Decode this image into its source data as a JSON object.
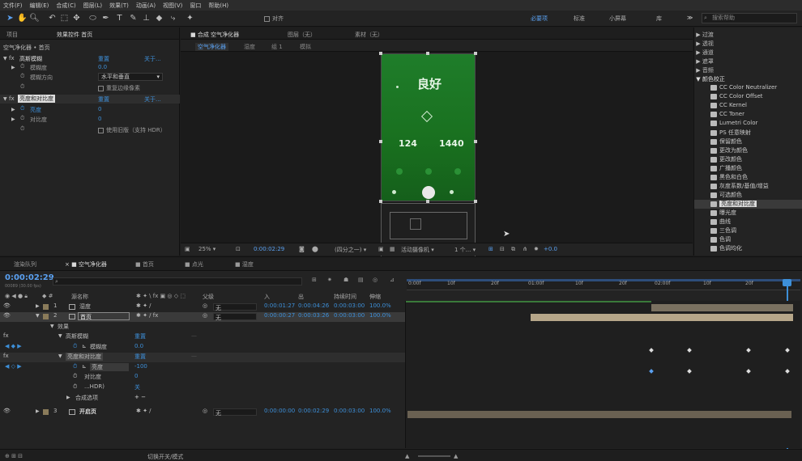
{
  "menu": [
    "文件(F)",
    "编辑(E)",
    "合成(C)",
    "图层(L)",
    "效果(T)",
    "动画(A)",
    "视图(V)",
    "窗口",
    "帮助(H)"
  ],
  "toolbar": {
    "align_label": "对齐",
    "workspaces": [
      "必要项",
      "标准",
      "小屏幕",
      "库"
    ],
    "search_placeholder": "搜索帮助"
  },
  "left_panel": {
    "tabs": [
      "项目",
      "效果控件 首页"
    ],
    "breadcrumb": "空气净化器 • 首页",
    "effects": [
      {
        "name": "高斯模糊",
        "reset": "重置",
        "about": "关于..."
      },
      {
        "name": "亮度和对比度",
        "reset": "重置",
        "about": "关于..."
      }
    ],
    "blur_label": "模糊度",
    "blur_value": "0.0",
    "dir_label": "模糊方向",
    "dir_value": "水平和垂直",
    "repeat_label": "重复边缘像素",
    "brightness_label": "亮度",
    "brightness_value": "0",
    "contrast_label": "对比度",
    "contrast_value": "0",
    "legacy_label": "使用旧版（支持 HDR）"
  },
  "comp_panel": {
    "tabs": [
      "合成 空气净化器",
      "图层（无）",
      "素材（无）"
    ],
    "crumbs": [
      "空气净化器",
      "湿度",
      "组 1",
      "模拟"
    ],
    "phone": {
      "status": "良好",
      "big_left": "124",
      "big_right": "1440"
    },
    "zoom": "25%",
    "time": "0:00:02:29",
    "quality": "(四分之一)",
    "camera": "活动摄像机",
    "views": "1 个...",
    "offset": "+0.0"
  },
  "effects_panel": {
    "groups": [
      "过渡",
      "透视",
      "通道",
      "遮罩",
      "音频",
      "颜色校正"
    ],
    "items": [
      "CC Color Neutralizer",
      "CC Color Offset",
      "CC Kernel",
      "CC Toner",
      "Lumetri Color",
      "PS 任意映射",
      "保留颜色",
      "更改为颜色",
      "更改颜色",
      "广播颜色",
      "黑色和白色",
      "灰度系数/基值/增益",
      "可选颜色",
      "亮度和对比度",
      "曝光度",
      "曲线",
      "三色调",
      "色调",
      "色调均化"
    ],
    "selected_index": 13
  },
  "timeline": {
    "tabs": [
      "渲染队列",
      "空气净化器",
      "首页",
      "点光",
      "湿度"
    ],
    "timecode": "0:00:02:29",
    "timecode_sub": "00089 (30.00 fps)",
    "columns": {
      "name": "源名称",
      "parent": "父级",
      "in": "入",
      "out": "出",
      "duration": "持续时间",
      "stretch": "伸缩"
    },
    "ruler": [
      "0:00f",
      "10f",
      "20f",
      "01:00f",
      "10f",
      "20f",
      "02:00f",
      "10f",
      "20f"
    ],
    "layers": [
      {
        "num": "1",
        "name": "湿度",
        "parent": "无",
        "in": "0:00:01:27",
        "out": "0:00:04:26",
        "dur": "0:00:03:00",
        "stretch": "100.0%"
      },
      {
        "num": "2",
        "name": "首页",
        "parent": "无",
        "in": "0:00:00:27",
        "out": "0:00:03:26",
        "dur": "0:00:03:00",
        "stretch": "100.0%"
      },
      {
        "num": "3",
        "name": "开启页",
        "parent": "无",
        "in": "0:00:00:00",
        "out": "0:00:02:29",
        "dur": "0:00:03:00",
        "stretch": "100.0%"
      }
    ],
    "sub": {
      "effects": "效果",
      "blur": "高斯模糊",
      "reset": "重置",
      "blur_prop": "模糊度",
      "blur_val": "0.0",
      "bc": "亮度和对比度",
      "bright": "亮度",
      "bright_val": "-100",
      "contrast": "对比度",
      "contrast_val": "0",
      "hdr": "...HDR)",
      "hdr_val": "关",
      "blend": "合成选项"
    },
    "footer": "切换开关/模式"
  },
  "colors": {
    "accent": "#3d8fd8",
    "green": "#1f7d2a"
  }
}
